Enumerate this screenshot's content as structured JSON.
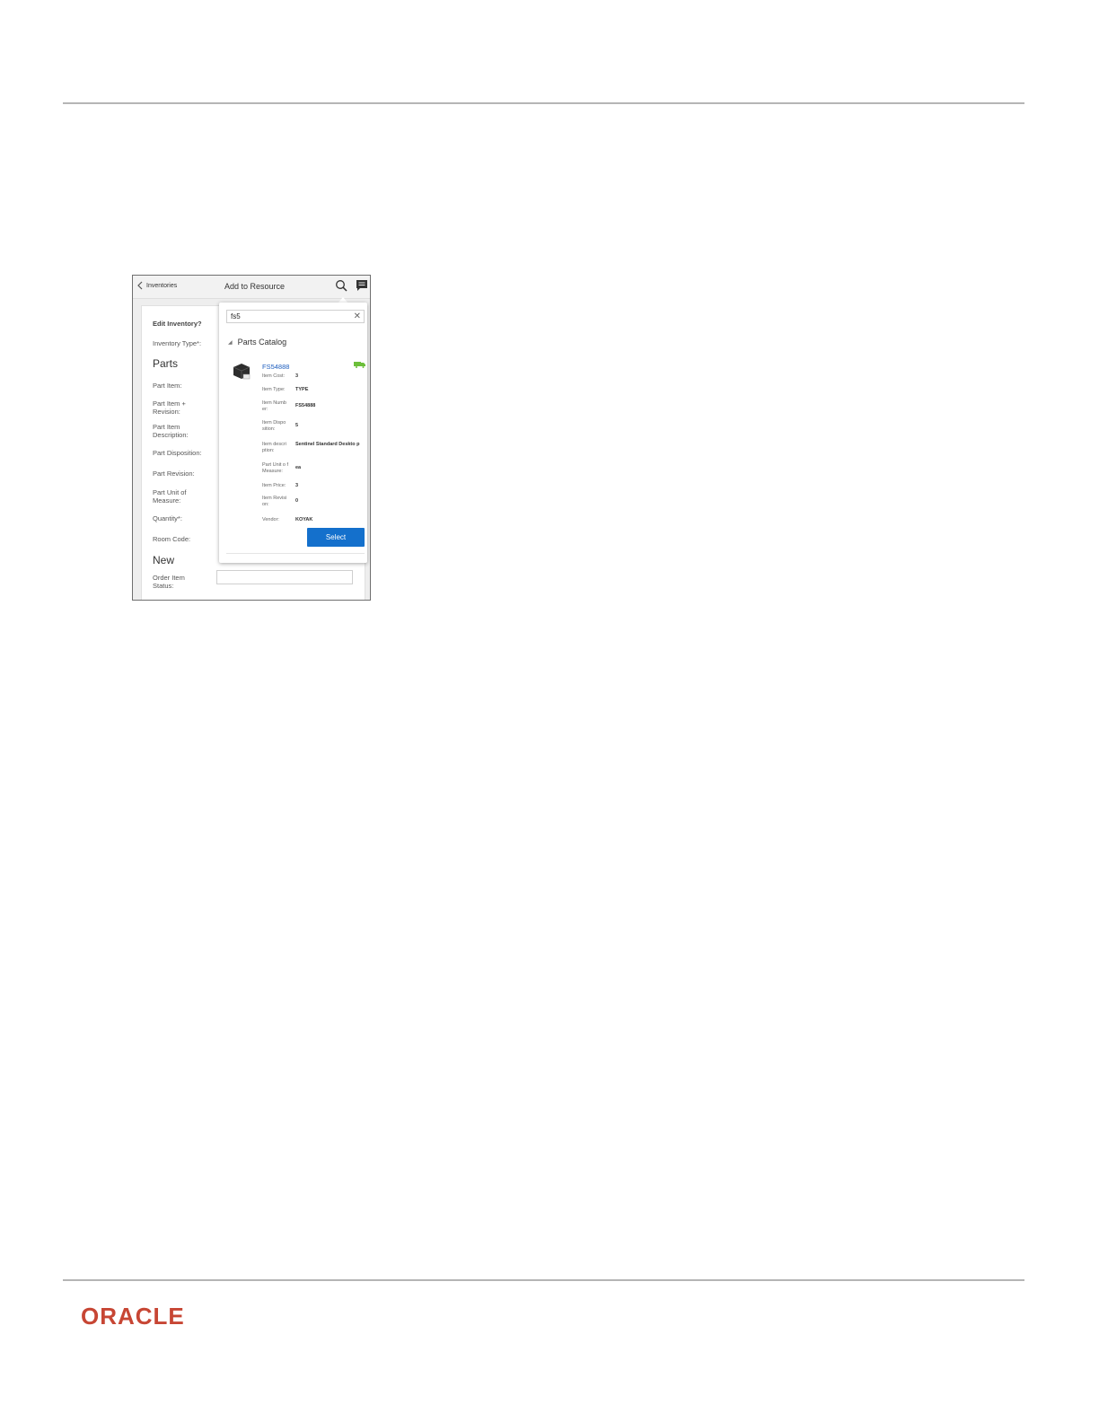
{
  "logo_text": "ORACLE",
  "logo_color": "#c74634",
  "app": {
    "back_label": "Inventories",
    "title": "Add to Resource",
    "icons": [
      "search-icon",
      "chat-icon",
      "chevron-left-icon"
    ]
  },
  "form": {
    "edit_inventory": "Edit Inventory?",
    "inventory_type": "Inventory Type*:",
    "section_parts": "Parts",
    "part_item": "Part Item:",
    "part_item_revision": "Part Item + Revision:",
    "part_item_description": "Part Item Description:",
    "part_disposition": "Part Disposition:",
    "part_revision": "Part Revision:",
    "part_unit_of_measure": "Part Unit of Measure:",
    "quantity": "Quantity*:",
    "room_code": "Room Code:",
    "section_new": "New",
    "order_item_status": "Order Item Status:"
  },
  "popover": {
    "search_value": "fs5",
    "catalog_title": "Parts Catalog",
    "item": {
      "number_link": "FS54888",
      "fields": [
        {
          "key": "Item Cost:",
          "value": "3"
        },
        {
          "key": "Item Type:",
          "value": "TYPE"
        },
        {
          "key": "Item Numb er:",
          "value": "FS54888"
        },
        {
          "key": "Item Dispo sition:",
          "value": "5"
        },
        {
          "key": "Item descri ption:",
          "value": "Sentinel Standard Deskto p"
        },
        {
          "key": "Part Unit o f Measure:",
          "value": "ea"
        },
        {
          "key": "Item Price:",
          "value": "3"
        },
        {
          "key": "Item Revisi on:",
          "value": "0"
        },
        {
          "key": "Vendor:",
          "value": "KOYAK"
        }
      ]
    },
    "select_label": "Select"
  },
  "accent_color": "#1470cc"
}
